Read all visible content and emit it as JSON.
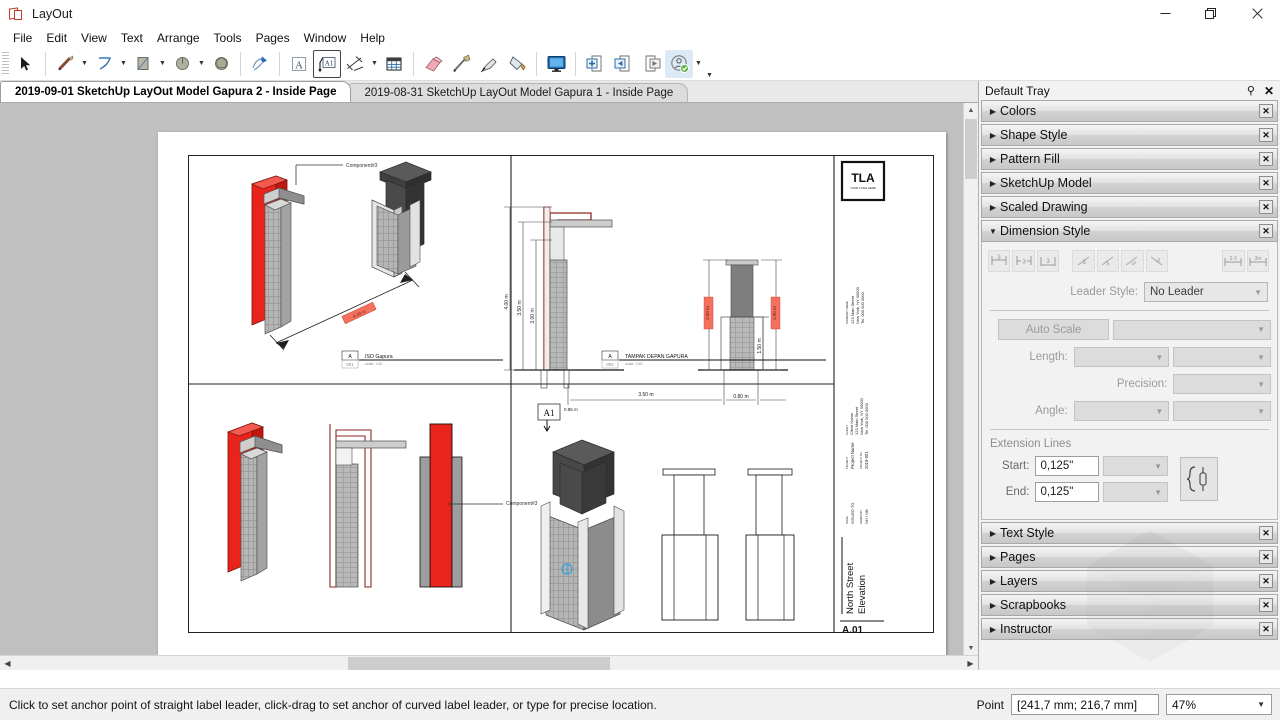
{
  "window": {
    "title": "LayOut",
    "app_icon": "layout-logo-icon",
    "minimize": "—",
    "maximize": "❐",
    "close": "✕"
  },
  "menubar": {
    "items": [
      "File",
      "Edit",
      "View",
      "Text",
      "Arrange",
      "Tools",
      "Pages",
      "Window",
      "Help"
    ]
  },
  "toolbar": {
    "groups": [
      {
        "buttons": [
          {
            "name": "select-tool",
            "icon": "arrow-cursor-icon"
          }
        ]
      },
      {
        "buttons": [
          {
            "name": "line-tool",
            "icon": "pencil-icon",
            "caret": true
          },
          {
            "name": "arc-tool",
            "icon": "arc-icon",
            "caret": true
          },
          {
            "name": "rectangle-tool",
            "icon": "rectangle-icon",
            "caret": true
          },
          {
            "name": "circle-tool",
            "icon": "circle-icon",
            "caret": true
          },
          {
            "name": "polygon-tool",
            "icon": "polygon-icon"
          }
        ]
      },
      {
        "buttons": [
          {
            "name": "eraser-lasso-tool",
            "icon": "split-tool-icon"
          }
        ]
      },
      {
        "buttons": [
          {
            "name": "text-tool",
            "icon": "text-box-icon"
          },
          {
            "name": "label-tool",
            "icon": "label-leader-icon",
            "active": true
          },
          {
            "name": "dimension-tool",
            "icon": "dimension-icon",
            "caret": true
          },
          {
            "name": "table-tool",
            "icon": "table-grid-icon"
          }
        ]
      },
      {
        "buttons": [
          {
            "name": "eraser-tool",
            "icon": "eraser-icon"
          },
          {
            "name": "style-picker-tool",
            "icon": "eyedropper-icon"
          },
          {
            "name": "pen-tool",
            "icon": "pen-nib-icon"
          },
          {
            "name": "paint-bucket-tool",
            "icon": "paint-bucket-icon"
          }
        ]
      },
      {
        "buttons": [
          {
            "name": "start-presentation",
            "icon": "monitor-icon"
          }
        ]
      },
      {
        "buttons": [
          {
            "name": "add-page",
            "icon": "page-add-icon"
          },
          {
            "name": "previous-page",
            "icon": "page-previous-icon"
          },
          {
            "name": "next-page",
            "icon": "page-next-icon"
          },
          {
            "name": "share-model",
            "icon": "user-check-icon",
            "highlight": true,
            "caret": true
          }
        ]
      }
    ]
  },
  "tabs": {
    "items": [
      {
        "label": "2019-09-01 SketchUp LayOut Model Gapura 2 - Inside Page",
        "active": true
      },
      {
        "label": "2019-08-31 SketchUp LayOut Model Gapura 1 - Inside Page",
        "active": false
      }
    ],
    "dropdown_icon": "chevron-down-icon",
    "close_icon": "close-icon"
  },
  "tray": {
    "title": "Default Tray",
    "pin_icon": "pin-icon",
    "close_icon": "close-icon",
    "panels": [
      {
        "label": "Colors",
        "expanded": false
      },
      {
        "label": "Shape Style",
        "expanded": false
      },
      {
        "label": "Pattern Fill",
        "expanded": false
      },
      {
        "label": "SketchUp Model",
        "expanded": false
      },
      {
        "label": "Scaled Drawing",
        "expanded": false
      },
      {
        "label": "Dimension Style",
        "expanded": true
      },
      {
        "label": "Text Style",
        "expanded": false
      },
      {
        "label": "Pages",
        "expanded": false
      },
      {
        "label": "Layers",
        "expanded": false
      },
      {
        "label": "Scrapbooks",
        "expanded": false
      },
      {
        "label": "Instructor",
        "expanded": false
      }
    ],
    "dimension_style": {
      "align_buttons": [
        "dim-text-below-icon",
        "dim-text-center-icon",
        "dim-text-above-icon",
        "dim-text-rotate-horizontal-icon",
        "dim-text-rotate-aligned-icon",
        "dim-text-rotate-vertical-icon",
        "dim-text-rotate-perpendicular-icon"
      ],
      "units_buttons": [
        "dim-show-units-icon",
        "dim-hide-units-icon"
      ],
      "leader_style_label": "Leader Style:",
      "leader_style_value": "No Leader",
      "auto_scale_label": "Auto Scale",
      "auto_scale_value": "",
      "length_label": "Length:",
      "length_value": "",
      "length_unit_value": "",
      "precision_label": "Precision:",
      "precision_value": "",
      "angle_label": "Angle:",
      "angle_value": "",
      "angle_unit_value": "",
      "extension_lines_label": "Extension Lines",
      "start_label": "Start:",
      "start_value": "0,125\"",
      "start_dropdown_value": "",
      "end_label": "End:",
      "end_value": "0,125\"",
      "end_dropdown_value": "",
      "extension_style_icon": "extension-line-style-icon"
    }
  },
  "statusbar": {
    "message": "Click to set anchor point of straight label leader, click-drag to set anchor of curved label leader, or type for precise location.",
    "point_label": "Point",
    "point_value": "[241,7 mm; 216,7 mm]",
    "zoom_value": "47%",
    "zoom_chevron_icon": "chevron-down-icon"
  },
  "canvas": {
    "scroll_left_icon": "chevron-left-icon",
    "scroll_right_icon": "chevron-right-icon",
    "scroll_up_icon": "chevron-up-icon",
    "scroll_down_icon": "chevron-down-icon"
  },
  "drawing": {
    "viewport_1": {
      "label_text": "Component#3",
      "dimension_text": "4.00 m",
      "title_number": "A",
      "title_sub": "001",
      "title_text": "ISO Gapura",
      "title_scale": "scale: 1:50"
    },
    "viewport_2": {
      "dims_vertical": [
        "4.00 m",
        "3.50 m",
        "3.00 m"
      ],
      "dims_horizontal": [
        "3.50 m",
        "0.80 m"
      ],
      "dim_small": "0.85 m",
      "dims_red": [
        "2.00 m",
        "2.00 m"
      ],
      "dim_right": "1.50 m",
      "label_marker": "A1",
      "title_number": "A",
      "title_sub": "002",
      "title_text": "TAMPAK DEPAN GAPURA",
      "title_scale": "scale: 1:50"
    },
    "viewport_3": {
      "label_text": "Component#3"
    },
    "viewport_4": {
      "marker": "1"
    },
    "titleblock": {
      "logo": "TLA",
      "logo_sub": "YOUR LOGO HERE",
      "company_caption": "COMPANY NAME",
      "company_lines": [
        "123 Main Street",
        "New York, NY 00000",
        "Tel. 000 000 0000"
      ],
      "client_caption": "CLIENT",
      "client_lines": [
        "Client Name",
        "123 Main Street",
        "New York, NY 00000",
        "Tel. 000 000 0000"
      ],
      "project_caption": "PROJECT",
      "project_value": "Project Name",
      "projectno_caption": "PROJECT NO.",
      "projectno_value": "2019-001",
      "issue_caption": "ISSUE",
      "issue_value": "ISSUED TO",
      "drawnby_caption": "DRAWN BY",
      "drawnby_value": "NH / NB",
      "sheet_title": "North Street\nElevation",
      "sheet_number": "A.01"
    }
  },
  "colors": {
    "accent_red": "#e8241c",
    "concrete_gray": "#9a9a9a",
    "dark_gray": "#4a4a4a",
    "canvas_bg": "#c0c0c0",
    "tray_bg": "#f2f2f2",
    "tab_active_bg": "#ffffff",
    "highlight_blue": "#dce9f7"
  }
}
